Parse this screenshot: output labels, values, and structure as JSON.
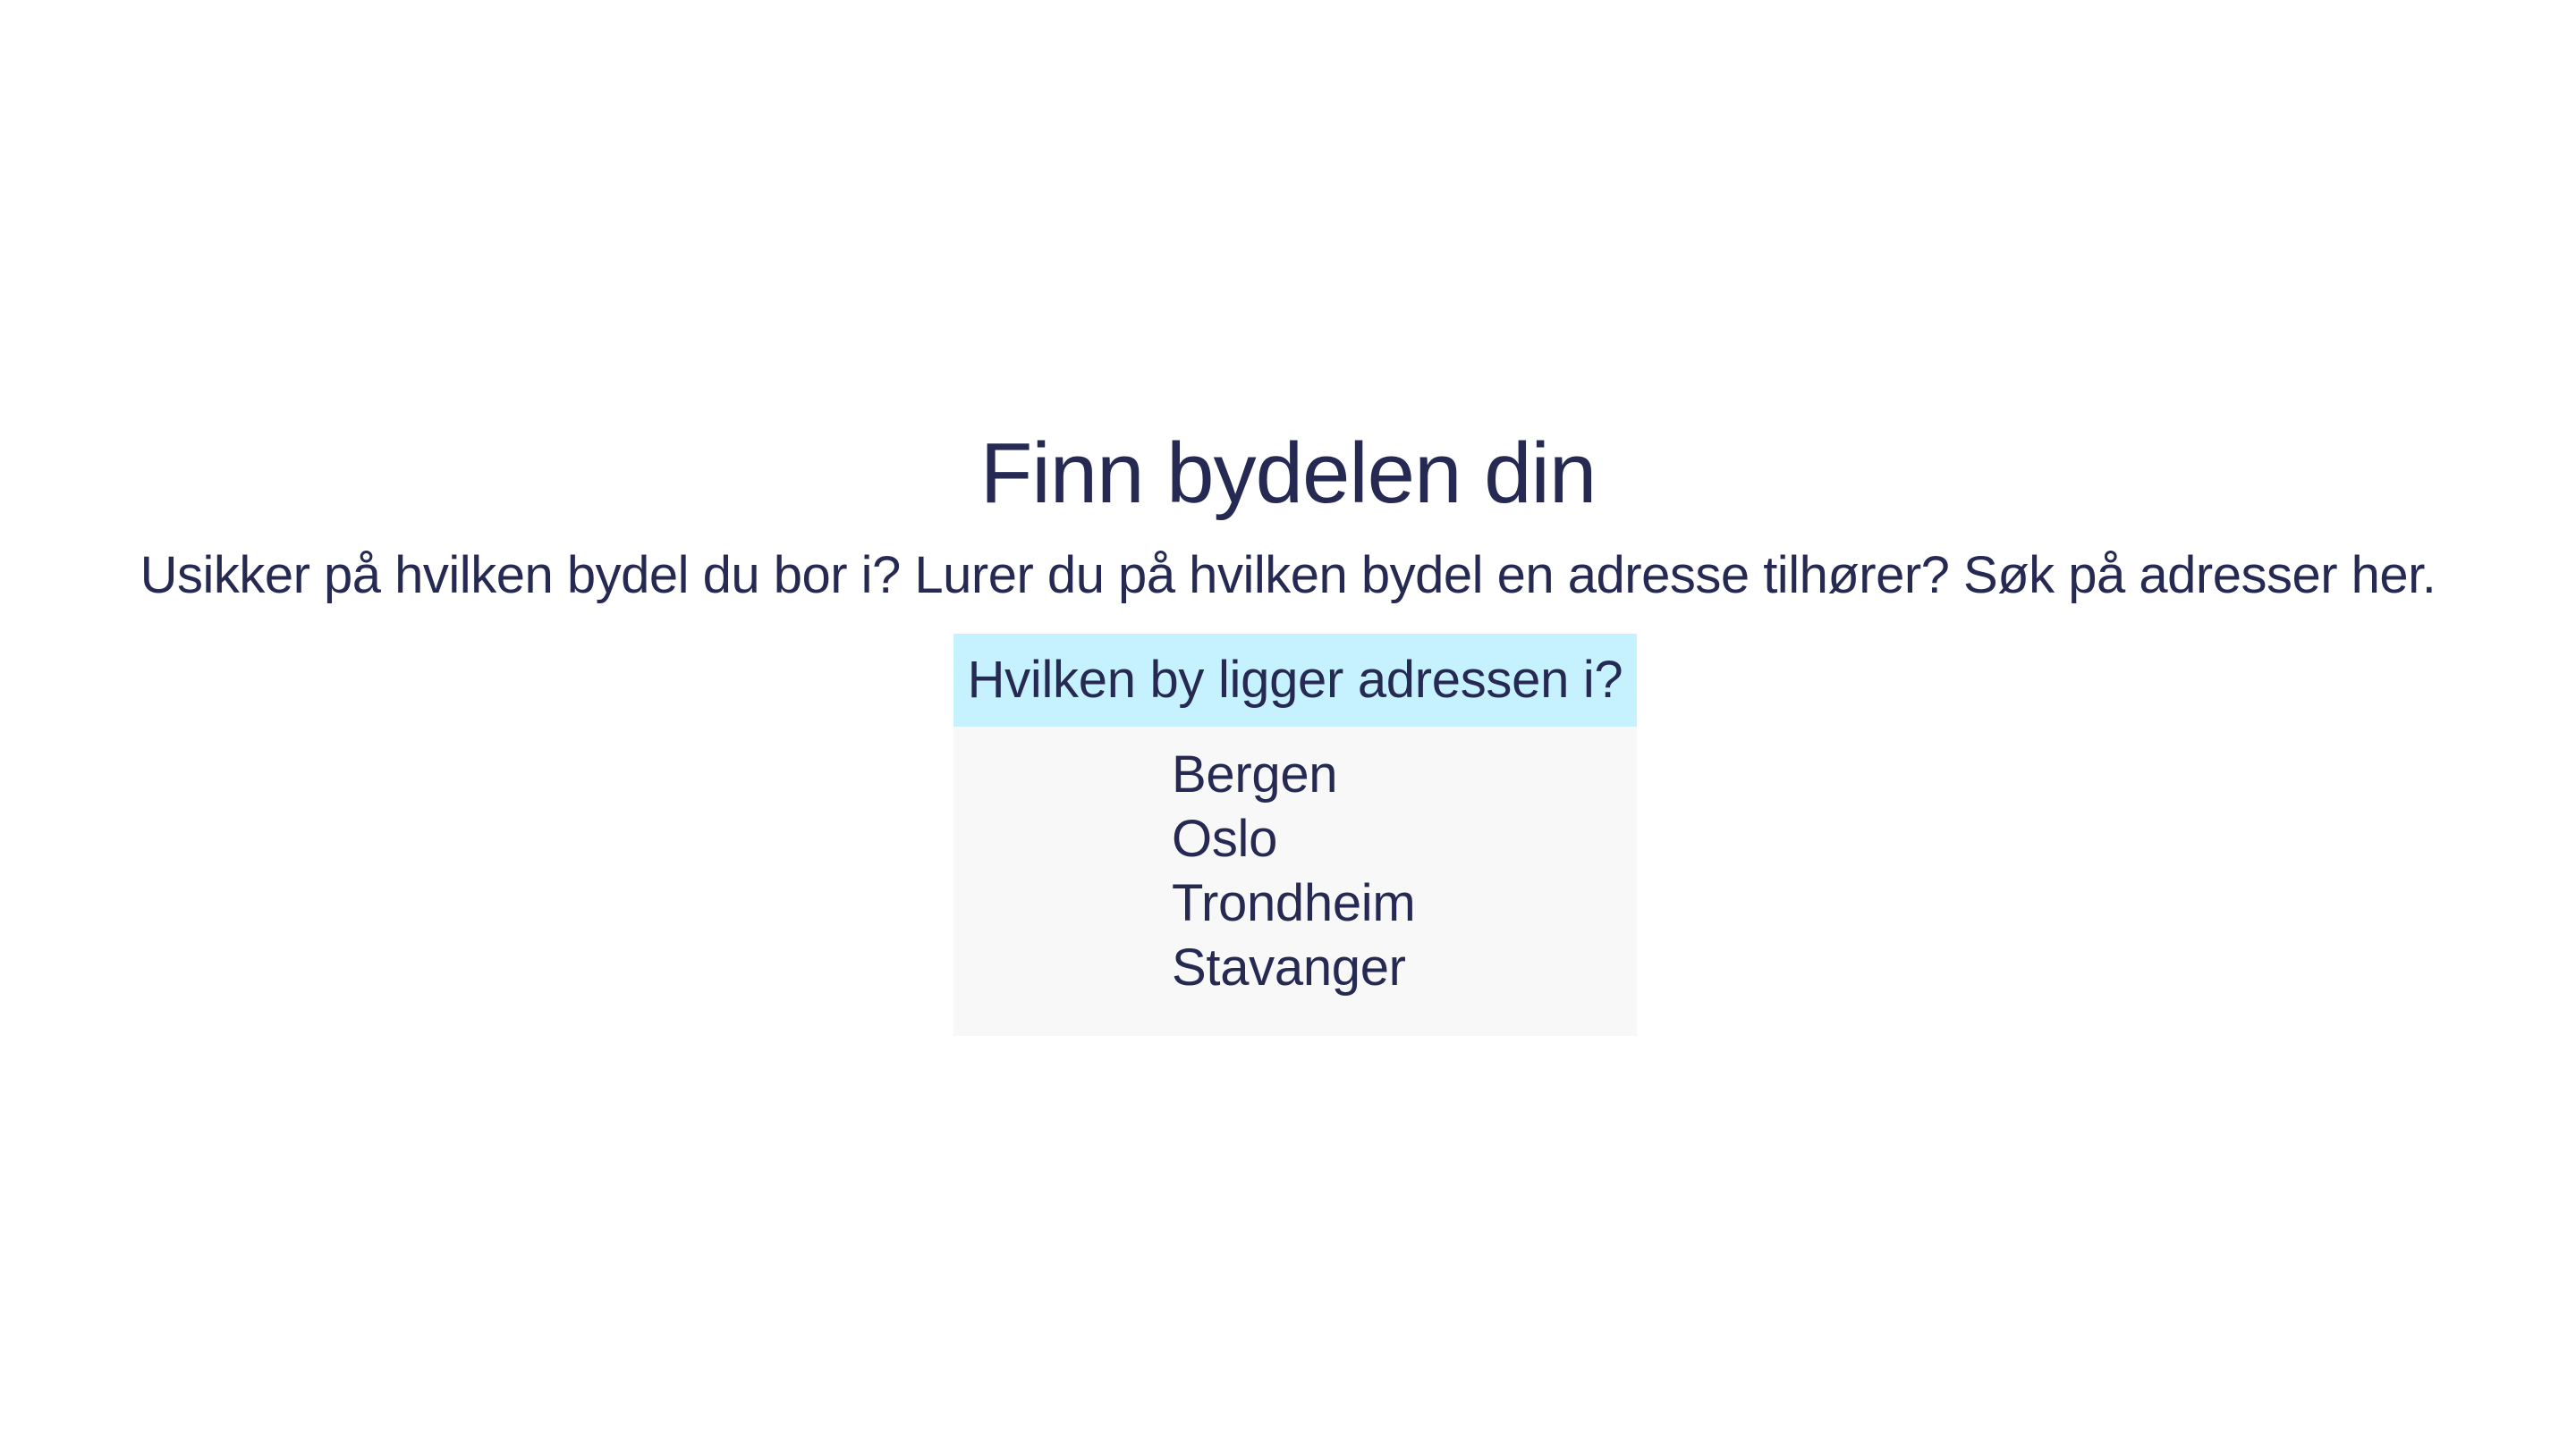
{
  "header": {
    "title": "Finn bydelen din",
    "subtitle": "Usikker på hvilken bydel du bor i? Lurer du på hvilken bydel en adresse tilhører? Søk på adresser her."
  },
  "city_selector": {
    "question": "Hvilken by ligger adressen i?",
    "options": [
      "Bergen",
      "Oslo",
      "Trondheim",
      "Stavanger"
    ]
  },
  "colors": {
    "text": "#262a53",
    "question_background": "#c5f2fe",
    "options_background": "#f8f8f8"
  }
}
